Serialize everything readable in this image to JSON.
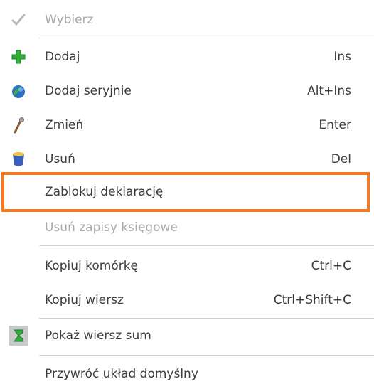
{
  "menu": {
    "items": [
      {
        "label": "Wybierz",
        "shortcut": "",
        "icon": "checkmark-icon",
        "disabled": true
      },
      {
        "label": "Dodaj",
        "shortcut": "Ins",
        "icon": "plus-icon",
        "disabled": false
      },
      {
        "label": "Dodaj seryjnie",
        "shortcut": "Alt+Ins",
        "icon": "multi-add-icon",
        "disabled": false
      },
      {
        "label": "Zmień",
        "shortcut": "Enter",
        "icon": "pen-icon",
        "disabled": false
      },
      {
        "label": "Usuń",
        "shortcut": "Del",
        "icon": "trash-icon",
        "disabled": false
      },
      {
        "label": "Zablokuj deklarację",
        "shortcut": "",
        "icon": "",
        "disabled": false,
        "highlighted": true
      },
      {
        "label": "Usuń zapisy księgowe",
        "shortcut": "",
        "icon": "",
        "disabled": true
      },
      {
        "label": "Kopiuj komórkę",
        "shortcut": "Ctrl+C",
        "icon": "",
        "disabled": false
      },
      {
        "label": "Kopiuj wiersz",
        "shortcut": "Ctrl+Shift+C",
        "icon": "",
        "disabled": false
      },
      {
        "label": "Pokaż wiersz sum",
        "shortcut": "",
        "icon": "sum-icon",
        "disabled": false,
        "checked": true
      },
      {
        "label": "Przywróć układ domyślny",
        "shortcut": "",
        "icon": "",
        "disabled": false
      }
    ]
  },
  "colors": {
    "highlight_border": "#f07b24",
    "text": "#3c3c3c",
    "disabled_text": "#a8a8a8",
    "separator": "#d0d0d0"
  }
}
